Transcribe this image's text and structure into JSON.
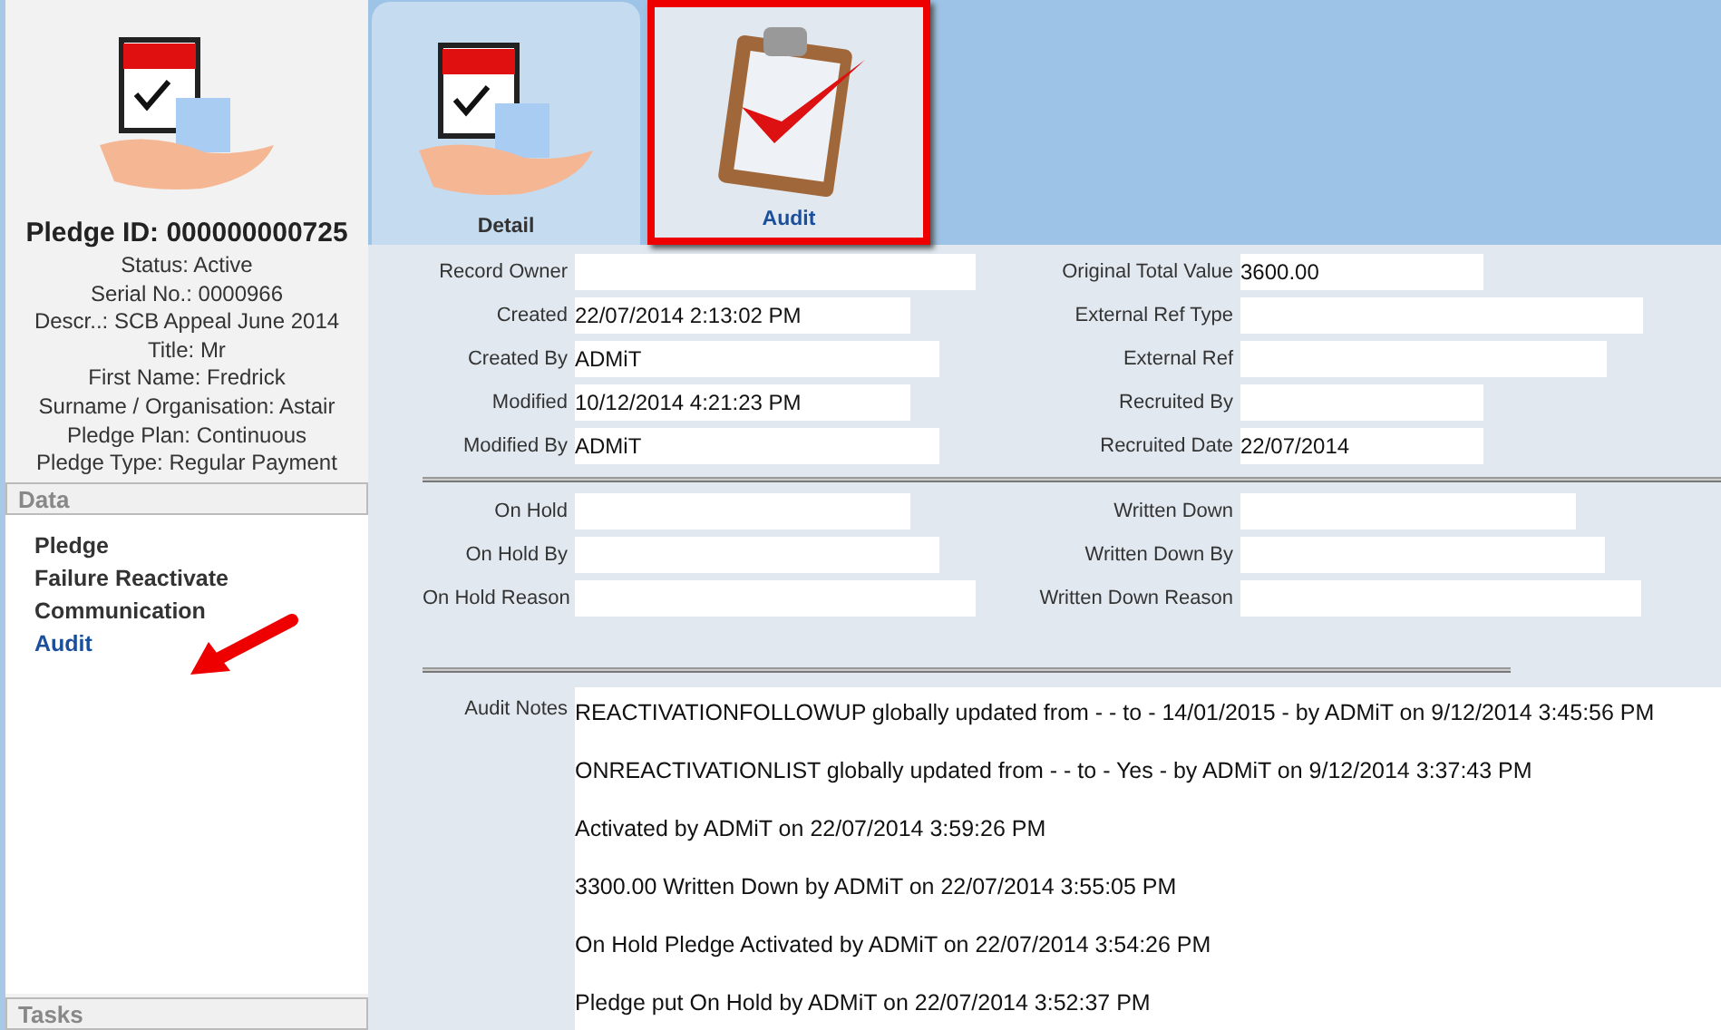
{
  "sidebar": {
    "pledge_id": "Pledge ID: 000000000725",
    "details": [
      "Status: Active",
      "Serial No.: 0000966",
      "Descr..: SCB Appeal June 2014",
      "Title: Mr",
      "First Name: Fredrick",
      "Surname / Organisation: Astair",
      "Pledge Plan: Continuous",
      "Pledge Type: Regular Payment"
    ],
    "sections": [
      {
        "title": "Data",
        "items": [
          {
            "label": "Pledge",
            "selected": false
          },
          {
            "label": "Failure Reactivate",
            "selected": false
          },
          {
            "label": "Communication",
            "selected": false
          },
          {
            "label": "Audit",
            "selected": true
          }
        ]
      },
      {
        "title": "Tasks"
      }
    ]
  },
  "tabs": [
    {
      "label": "Detail",
      "kind": "detail",
      "selected": false
    },
    {
      "label": "Audit",
      "kind": "audit",
      "selected": true
    }
  ],
  "form": {
    "sections": [
      {
        "left": [
          {
            "label": "Record Owner"
          },
          {
            "label": "Created",
            "value": "22/07/2014 2:13:02 PM"
          },
          {
            "label": "Created By",
            "value": "ADMiT"
          },
          {
            "label": "Modified",
            "value": "10/12/2014 4:21:23 PM"
          },
          {
            "label": "Modified By",
            "value": "ADMiT"
          }
        ],
        "right": [
          {
            "label": "Original Total Value",
            "value": "3600.00"
          },
          {
            "label": "External Ref Type"
          },
          {
            "label": "External Ref"
          },
          {
            "label": "Recruited By"
          },
          {
            "label": "Recruited Date",
            "value": "22/07/2014"
          }
        ]
      },
      {
        "left": [
          {
            "label": "On Hold"
          },
          {
            "label": "On Hold By"
          },
          {
            "label": "On Hold Reason"
          }
        ],
        "right": [
          {
            "label": "Written Down"
          },
          {
            "label": "Written Down By"
          },
          {
            "label": "Written Down Reason"
          }
        ]
      }
    ],
    "audit_notes": {
      "label": "Audit Notes",
      "notes": [
        "REACTIVATIONFOLLOWUP globally updated from -  - to - 14/01/2015 - by ADMiT on 9/12/2014 3:45:56 PM",
        "ONREACTIVATIONLIST globally updated from -  - to - Yes - by ADMiT on 9/12/2014 3:37:43 PM",
        "Activated by ADMiT on 22/07/2014 3:59:26 PM",
        "3300.00 Written Down by ADMiT on 22/07/2014 3:55:05 PM",
        "On Hold Pledge Activated by ADMiT on 22/07/2014 3:54:26 PM",
        "Pledge put On Hold by ADMiT on 22/07/2014 3:52:37 PM"
      ]
    }
  }
}
